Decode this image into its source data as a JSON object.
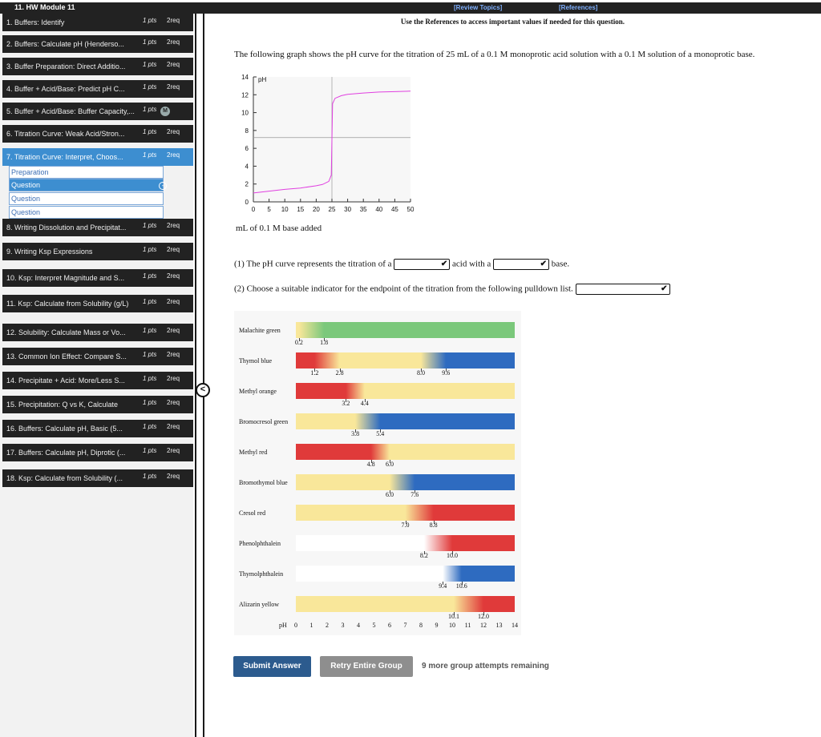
{
  "header": {
    "module_title": "11. HW Module 11",
    "review_topics": "[Review Topics]",
    "references": "[References]"
  },
  "sidebar": {
    "items": [
      {
        "label": "1. Buffers: Identify",
        "pts": "1 pts",
        "req": "2req"
      },
      {
        "label": "2. Buffers: Calculate pH (Henderso...",
        "pts": "1 pts",
        "req": "2req"
      },
      {
        "label": "3. Buffer Preparation: Direct Additio...",
        "pts": "1 pts",
        "req": "2req"
      },
      {
        "label": "4. Buffer + Acid/Base: Predict pH C...",
        "pts": "1 pts",
        "req": "2req"
      },
      {
        "label": "5. Buffer + Acid/Base: Buffer Capacity,...",
        "pts": "1 pts",
        "req": "M"
      },
      {
        "label": "6. Titration Curve: Weak Acid/Stron...",
        "pts": "1 pts",
        "req": "2req"
      },
      {
        "label": "7. Titration Curve: Interpret, Choos...",
        "pts": "1 pts",
        "req": "2req"
      },
      {
        "label": "8. Writing Dissolution and Precipitat...",
        "pts": "1 pts",
        "req": "2req"
      },
      {
        "label": "9. Writing Ksp Expressions",
        "pts": "1 pts",
        "req": "2req"
      },
      {
        "label": "10. Ksp: Interpret Magnitude and S...",
        "pts": "1 pts",
        "req": "2req"
      },
      {
        "label": "11. Ksp: Calculate from Solubility (g/L)",
        "pts": "1 pts",
        "req": "2req"
      },
      {
        "label": "12. Solubility: Calculate Mass or Vo...",
        "pts": "1 pts",
        "req": "2req"
      },
      {
        "label": "13. Common Ion Effect: Compare S...",
        "pts": "1 pts",
        "req": "2req"
      },
      {
        "label": "14. Precipitate + Acid: More/Less S...",
        "pts": "1 pts",
        "req": "2req"
      },
      {
        "label": "15. Precipitation: Q vs K, Calculate",
        "pts": "1 pts",
        "req": "2req"
      },
      {
        "label": "16. Buffers: Calculate pH, Basic (5...",
        "pts": "1 pts",
        "req": "2req"
      },
      {
        "label": "17. Buffers: Calculate pH, Diprotic (...",
        "pts": "1 pts",
        "req": "2req"
      },
      {
        "label": "18. Ksp: Calculate from Solubility (...",
        "pts": "1 pts",
        "req": "2req"
      }
    ],
    "subitems": [
      "Preparation",
      "Question",
      "Question",
      "Question"
    ]
  },
  "main": {
    "instruction": "Use the References to access important values if needed for this question.",
    "question": "The following graph shows the pH curve for the titration of 25 mL of a 0.1 M monoprotic acid solution with a 0.1 M solution of a monoprotic base.",
    "graph_xlabel": "mL of 0.1 M base added",
    "q1_prefix": "(1) The pH curve represents the titration of a",
    "q1_mid": "acid with a",
    "q1_suffix": "base.",
    "q2": "(2) Choose a suitable indicator for the endpoint of the titration from the following pulldown list.",
    "submit": "Submit Answer",
    "retry": "Retry Entire Group",
    "attempts": "9 more group attempts remaining"
  },
  "chart_data": {
    "type": "line",
    "ylabel": "pH",
    "xlabel": "mL of 0.1 M base added",
    "xlim": [
      0,
      50
    ],
    "ylim": [
      0,
      14
    ],
    "xticks": [
      0,
      5,
      10,
      15,
      20,
      25,
      30,
      35,
      40,
      45,
      50
    ],
    "yticks": [
      0,
      2,
      4,
      6,
      8,
      10,
      12,
      14
    ],
    "reference_line_y": 7.2,
    "reference_line_x": 25,
    "series": [
      {
        "color": "#e040e0",
        "x": [
          0,
          5,
          10,
          15,
          20,
          22,
          24,
          24.8,
          25,
          25.2,
          26,
          28,
          30,
          35,
          40,
          45,
          50
        ],
        "y": [
          1.0,
          1.2,
          1.4,
          1.55,
          1.8,
          1.95,
          2.3,
          3.0,
          7.0,
          11.0,
          11.6,
          11.9,
          12.05,
          12.2,
          12.3,
          12.35,
          12.4
        ]
      }
    ]
  },
  "indicators": {
    "ph_label": "pH",
    "ph_ticks": [
      0,
      1,
      2,
      3,
      4,
      5,
      6,
      7,
      8,
      9,
      10,
      11,
      12,
      13,
      14
    ],
    "items": [
      {
        "name": "Malachite green",
        "ranges": [
          [
            0.2,
            1.8
          ]
        ],
        "labels": [
          "0.2",
          "1.8"
        ],
        "colors": [
          "#f9e79a",
          "#7bc87b"
        ]
      },
      {
        "name": "Thymol blue",
        "ranges": [
          [
            1.2,
            2.8
          ],
          [
            8.0,
            9.6
          ]
        ],
        "labels": [
          "1.2",
          "2.8",
          "8.0",
          "9.6"
        ],
        "colors": [
          "#e03a3a",
          "#f9e79a",
          "#2e6bc0"
        ]
      },
      {
        "name": "Methyl orange",
        "ranges": [
          [
            3.2,
            4.4
          ]
        ],
        "labels": [
          "3.2",
          "4.4"
        ],
        "colors": [
          "#e03a3a",
          "#f9e79a"
        ]
      },
      {
        "name": "Bromocresol green",
        "ranges": [
          [
            3.8,
            5.4
          ]
        ],
        "labels": [
          "3.8",
          "5.4"
        ],
        "colors": [
          "#f9e79a",
          "#2e6bc0"
        ]
      },
      {
        "name": "Methyl red",
        "ranges": [
          [
            4.8,
            6.0
          ]
        ],
        "labels": [
          "4.8",
          "6.0"
        ],
        "colors": [
          "#e03a3a",
          "#f9e79a"
        ]
      },
      {
        "name": "Bromothymol blue",
        "ranges": [
          [
            6.0,
            7.6
          ]
        ],
        "labels": [
          "6.0",
          "7.6"
        ],
        "colors": [
          "#f9e79a",
          "#2e6bc0"
        ]
      },
      {
        "name": "Cresol red",
        "ranges": [
          [
            7.0,
            8.8
          ]
        ],
        "labels": [
          "7.0",
          "8.8"
        ],
        "colors": [
          "#f9e79a",
          "#e03a3a"
        ]
      },
      {
        "name": "Phenolphthalein",
        "ranges": [
          [
            8.2,
            10.0
          ]
        ],
        "labels": [
          "8.2",
          "10.0"
        ],
        "colors": [
          "#ffffff",
          "#e03a3a"
        ]
      },
      {
        "name": "Thymolphthalein",
        "ranges": [
          [
            9.4,
            10.6
          ]
        ],
        "labels": [
          "9.4",
          "10.6"
        ],
        "colors": [
          "#ffffff",
          "#2e6bc0"
        ]
      },
      {
        "name": "Alizarin yellow",
        "ranges": [
          [
            10.1,
            12.0
          ]
        ],
        "labels": [
          "10.1",
          "12.0"
        ],
        "colors": [
          "#f9e79a",
          "#e03a3a"
        ]
      }
    ]
  },
  "colors": {
    "sidebar_dark": "#222222",
    "active_blue": "#3d8ed0",
    "submit_blue": "#2c5b8e",
    "retry_gray": "#8e8e8e",
    "curve_magenta": "#e040e0"
  }
}
